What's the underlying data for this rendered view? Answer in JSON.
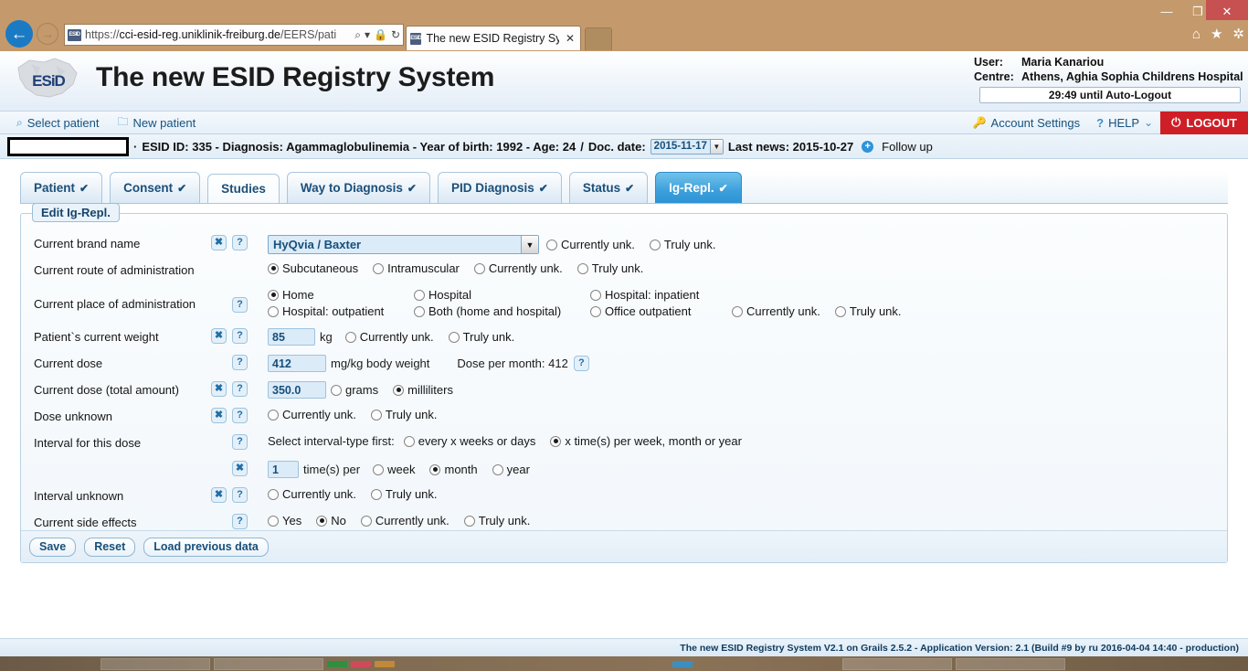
{
  "window": {
    "minimize": "—",
    "maximize": "❐",
    "close": "✕"
  },
  "browser": {
    "back_icon": "←",
    "forward_icon": "→",
    "url_prefix": "https://",
    "url_bold": "cci-esid-reg.uniklinik-freiburg.de",
    "url_suffix": "/EERS/pati",
    "search_icon": "⌕",
    "dropdown_icon": "▾",
    "lock_icon": "🔒",
    "refresh_icon": "↻",
    "favicon_text": "ESID",
    "tab_title": "The new ESID Registry Syste...",
    "tab_close": "✕",
    "home_icon": "⌂",
    "favorites_icon": "★",
    "settings_icon": "✲"
  },
  "header": {
    "app_title": "The new ESID Registry System",
    "logo_text": "ESiD",
    "user_label": "User:",
    "user_name": "Maria Kanariou",
    "centre_label": "Centre:",
    "centre_name": "Athens, Aghia Sophia Childrens Hospital",
    "autologout": "29:49 until Auto-Logout"
  },
  "nav": {
    "select_patient": "Select patient",
    "select_patient_icon": "⌕",
    "new_patient": "New patient",
    "new_patient_icon": "🗀",
    "account_settings": "Account Settings",
    "account_icon": "🔑",
    "help": "HELP",
    "help_icon": "?",
    "help_caret": "⌄",
    "logout": "LOGOUT",
    "logout_icon": "⏻"
  },
  "patient_bar": {
    "separator": "·",
    "esid_id": "ESID ID: 335 - Diagnosis: Agammaglobulinemia - Year of birth: 1992 - Age: 24",
    "slash": "/",
    "doc_date_label": "Doc. date:",
    "doc_date_value": "2015-11-17",
    "doc_date_caret": "▼",
    "last_news": "Last news: 2015-10-27",
    "followup_icon": "+",
    "followup": "Follow up"
  },
  "tabs": [
    {
      "label": "Patient",
      "tick": "✔",
      "state": "done"
    },
    {
      "label": "Consent",
      "tick": "✔",
      "state": "done"
    },
    {
      "label": "Studies",
      "tick": "",
      "state": "plain"
    },
    {
      "label": "Way to Diagnosis",
      "tick": "✔",
      "state": "done"
    },
    {
      "label": "PID Diagnosis",
      "tick": "✔",
      "state": "done"
    },
    {
      "label": "Status",
      "tick": "✔",
      "state": "done"
    },
    {
      "label": "Ig-Repl.",
      "tick": "✔",
      "state": "active"
    }
  ],
  "form": {
    "legend": "Edit Ig-Repl.",
    "clear_badge": "✖",
    "help_badge": "?",
    "rows": {
      "brand": {
        "label": "Current brand name",
        "selected": "HyQvia / Baxter",
        "caret": "▼",
        "opt_currently": "Currently unk.",
        "opt_truly": "Truly unk."
      },
      "route": {
        "label": "Current route of administration",
        "opts": [
          "Subcutaneous",
          "Intramuscular",
          "Currently unk.",
          "Truly unk."
        ],
        "selected": "Subcutaneous"
      },
      "place": {
        "label": "Current place of administration",
        "row1": [
          "Home",
          "Hospital",
          "Hospital: inpatient"
        ],
        "row2": [
          "Hospital: outpatient",
          "Both (home and hospital)",
          "Office outpatient",
          "Currently unk.",
          "Truly unk."
        ],
        "selected": "Home"
      },
      "weight": {
        "label": "Patient`s current weight",
        "value": "85",
        "unit": "kg",
        "opts": [
          "Currently unk.",
          "Truly unk."
        ]
      },
      "dose": {
        "label": "Current dose",
        "value": "412",
        "unit": "mg/kg body weight",
        "per_month": "Dose per month: 412"
      },
      "dose_total": {
        "label": "Current dose (total amount)",
        "value": "350.0",
        "opts": [
          "grams",
          "milliliters"
        ],
        "selected": "milliliters"
      },
      "dose_unknown": {
        "label": "Dose unknown",
        "opts": [
          "Currently unk.",
          "Truly unk."
        ]
      },
      "interval": {
        "label": "Interval for this dose",
        "prefix": "Select interval-type first:",
        "opts": [
          "every x weeks or days",
          "x time(s) per week, month or year"
        ],
        "selected": "x time(s) per week, month or year"
      },
      "interval_detail": {
        "value": "1",
        "mid": "time(s) per",
        "opts": [
          "week",
          "month",
          "year"
        ],
        "selected": "month"
      },
      "interval_unknown": {
        "label": "Interval unknown",
        "opts": [
          "Currently unk.",
          "Truly unk."
        ]
      },
      "side_effects": {
        "label": "Current side effects",
        "opts": [
          "Yes",
          "No",
          "Currently unk.",
          "Truly unk."
        ],
        "selected": "No"
      }
    },
    "actions": {
      "save": "Save",
      "reset": "Reset",
      "load_previous": "Load previous data"
    }
  },
  "footer": {
    "text": "The new ESID Registry System V2.1 on Grails 2.5.2 - Application Version: 2.1 (Build #9 by ru 2016-04-04 14:40 - production)"
  },
  "colors": {
    "accent_blue": "#2e93d5",
    "logout_red": "#cf1f26",
    "field_blue": "#dcebf8",
    "chrome_tan": "#c49a6c"
  }
}
